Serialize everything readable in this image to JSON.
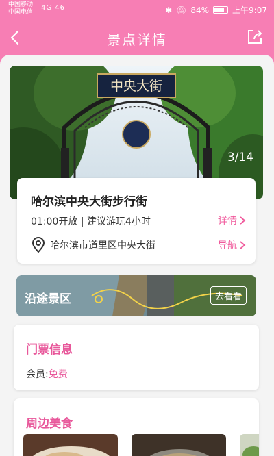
{
  "status_bar": {
    "carrier_1": "中国移动",
    "carrier_2": "中国电信",
    "signal": "4G 46",
    "battery": "84%",
    "time": "上午9:07"
  },
  "navbar": {
    "title": "景点详情",
    "back_icon": "chevron-left-icon",
    "share_icon": "share-icon"
  },
  "gallery": {
    "counter": "3/14",
    "sign_text": "中央大街"
  },
  "attraction": {
    "name": "哈尔滨中央大街步行街",
    "hours": "01:00开放",
    "separator": "|",
    "suggestion": "建议游玩4小时",
    "detail_label": "详情",
    "address": "哈尔滨市道里区中央大街",
    "navigate_label": "导航"
  },
  "route": {
    "label": "沿途景区",
    "button": "去看看"
  },
  "ticket": {
    "title": "门票信息",
    "member_prefix": "会员:",
    "member_value": "免费"
  },
  "food": {
    "title": "周边美食"
  },
  "colors": {
    "brand_pink": "#f77eb4",
    "accent_pink": "#e8579a"
  }
}
